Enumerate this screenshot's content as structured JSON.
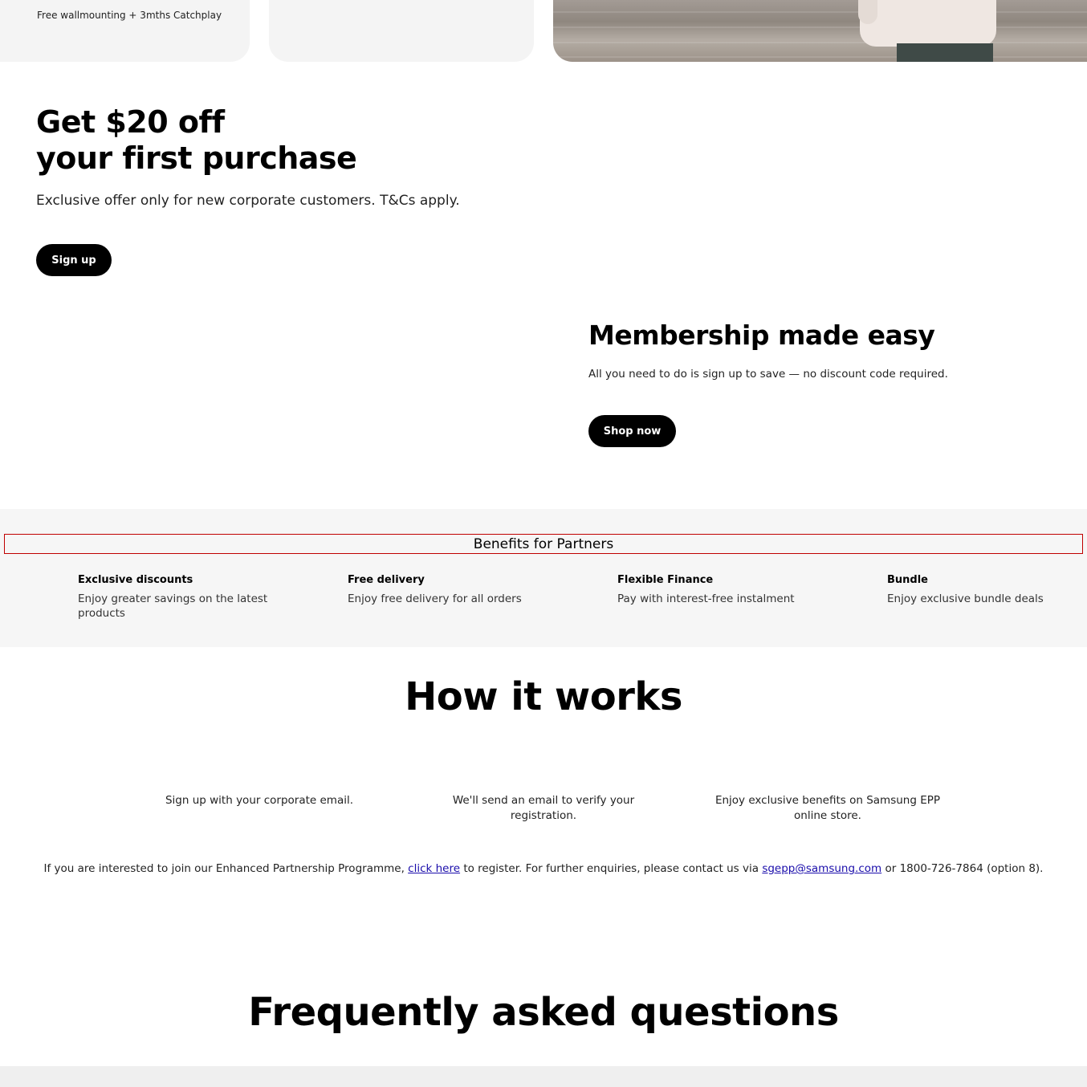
{
  "top_cards": {
    "card1_caption": "Free wallmounting + 3mths Catchplay"
  },
  "offer": {
    "title_line1": "Get $20 off",
    "title_line2": "your first purchase",
    "description": "Exclusive offer only for new corporate customers. T&Cs apply.",
    "button_label": "Sign up"
  },
  "membership": {
    "title": "Membership made easy",
    "description": "All you need to do is sign up to save — no discount code required.",
    "button_label": "Shop now"
  },
  "benefits": {
    "title": "Benefits for Partners",
    "items": [
      {
        "title": "Exclusive discounts",
        "desc": "Enjoy greater savings on the latest products"
      },
      {
        "title": "Free delivery",
        "desc": "Enjoy free delivery for all orders"
      },
      {
        "title": "Flexible Finance",
        "desc": "Pay with interest-free instalment"
      },
      {
        "title": "Bundle",
        "desc": "Enjoy exclusive bundle deals"
      }
    ]
  },
  "how_it_works": {
    "title": "How it works",
    "steps": [
      "Sign up with your corporate email.",
      "We'll send an email to verify your registration.",
      "Enjoy exclusive benefits on Samsung EPP online store."
    ]
  },
  "enquiry": {
    "text_before": "If you are interested to join our Enhanced Partnership Programme, ",
    "link1": "click here",
    "text_middle": " to register. For further enquiries, please contact us via ",
    "link2": "sgepp@samsung.com",
    "text_after": " or 1800-726-7864 (option 8)."
  },
  "faq": {
    "title": "Frequently asked questions"
  }
}
